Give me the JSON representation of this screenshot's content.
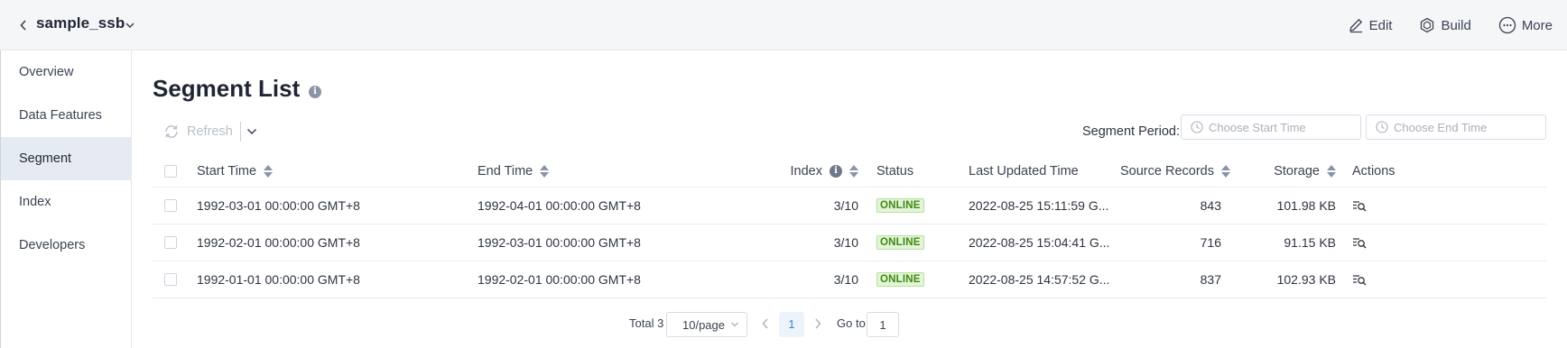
{
  "header": {
    "model_name": "sample_ssb",
    "actions": [
      {
        "label": "Edit",
        "icon": "pencil-icon"
      },
      {
        "label": "Build",
        "icon": "cube-icon"
      },
      {
        "label": "More",
        "icon": "more-dots-icon"
      }
    ]
  },
  "sidebar": {
    "items": [
      {
        "label": "Overview",
        "active": false
      },
      {
        "label": "Data Features",
        "active": false
      },
      {
        "label": "Segment",
        "active": true
      },
      {
        "label": "Index",
        "active": false
      },
      {
        "label": "Developers",
        "active": false
      }
    ]
  },
  "main": {
    "title": "Segment List",
    "refresh_label": "Refresh",
    "segment_period_label": "Segment Period:",
    "start_placeholder": "Choose Start Time",
    "end_placeholder": "Choose End Time"
  },
  "table": {
    "columns": {
      "start": "Start Time",
      "end": "End Time",
      "index": "Index",
      "status": "Status",
      "updated": "Last Updated Time",
      "source": "Source Records",
      "storage": "Storage",
      "actions": "Actions"
    },
    "rows": [
      {
        "start": "1992-03-01 00:00:00 GMT+8",
        "end": "1992-04-01 00:00:00 GMT+8",
        "index": "3/10",
        "status": "ONLINE",
        "updated": "2022-08-25 15:11:59 G...",
        "source": "843",
        "storage": "101.98 KB"
      },
      {
        "start": "1992-02-01 00:00:00 GMT+8",
        "end": "1992-03-01 00:00:00 GMT+8",
        "index": "3/10",
        "status": "ONLINE",
        "updated": "2022-08-25 15:04:41 G...",
        "source": "716",
        "storage": "91.15 KB"
      },
      {
        "start": "1992-01-01 00:00:00 GMT+8",
        "end": "1992-02-01 00:00:00 GMT+8",
        "index": "3/10",
        "status": "ONLINE",
        "updated": "2022-08-25 14:57:52 G...",
        "source": "837",
        "storage": "102.93 KB"
      }
    ]
  },
  "pagination": {
    "total": "Total 3",
    "page_size": "10/page",
    "current_page": "1",
    "goto_label": "Go to",
    "goto_value": "1"
  },
  "colors": {
    "online_text": "#3f8a12",
    "online_bg": "#e4f4d9",
    "accent": "#3b82d6"
  }
}
